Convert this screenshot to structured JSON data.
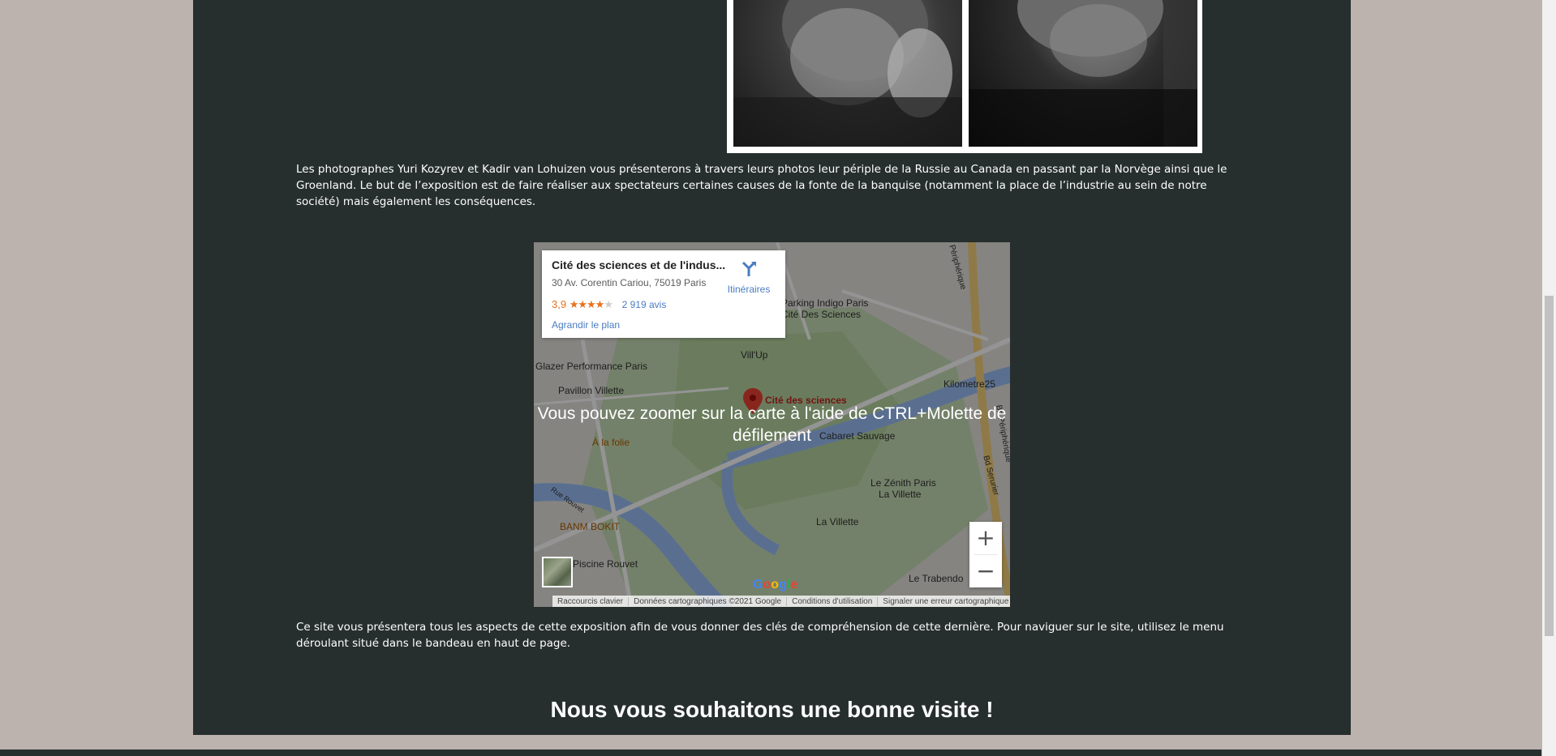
{
  "intro": {
    "paragraph": "Les photographes Yuri Kozyrev et Kadir van Lohuizen vous présenterons à travers leurs photos leur périple de la Russie au Canada en passant par la Norvège ainsi que le Groenland. Le but de l’exposition est de faire réaliser aux spectateurs certaines causes de la fonte de la banquise (notamment la place de l’industrie au sein de notre société) mais également les conséquences."
  },
  "map": {
    "card": {
      "place_name": "Cité des sciences et de l'indus...",
      "address": "30 Av. Corentin Cariou, 75019 Paris",
      "rating": "3,9",
      "rating_stars": 3.9,
      "reviews": "2 919 avis",
      "enlarge": "Agrandir le plan",
      "directions": "Itinéraires"
    },
    "zoom_hint": "Vous pouvez zoomer sur la carte à l'aide de CTRL+Molette de défilement",
    "labels": {
      "parking": "Parking Indigo Paris",
      "parking2": "Cité Des Sciences",
      "villup": "Vill'Up",
      "glazer": "Glazer Performance Paris",
      "pavillon": "Pavillon Villette",
      "kilometre": "Kilometre25",
      "cite": "Cité des sciences",
      "cabaret": "Cabaret Sauvage",
      "alafolie": "À la folie",
      "zenith": "Le Zénith Paris",
      "zenith2": "La Villette",
      "lavillette": "La Villette",
      "banm": "BANM BOKIT",
      "piscine": "Piscine Rouvet",
      "trabendo": "Le Trabendo",
      "rouvet": "Rue Rouvet",
      "serurier": "Bd Serurier",
      "peripherique": "Bd Périphérique",
      "periph_top": "Périphérique"
    },
    "zoom_in": "+",
    "zoom_out": "−",
    "google": "Google",
    "footer": {
      "shortcuts": "Raccourcis clavier",
      "data": "Données cartographiques ©2021 Google",
      "terms": "Conditions d'utilisation",
      "report": "Signaler une erreur cartographique"
    },
    "icons": {
      "directions": "directions-arrow-icon",
      "pin": "map-pin-icon"
    }
  },
  "outro": {
    "paragraph": "Ce site vous présentera tous les aspects de cette exposition afin de vous donner des clés de compréhension de cette dernière. Pour naviguer sur le site, utilisez le menu déroulant situé dans le bandeau en haut de page.",
    "closing": "Nous vous souhaitons une bonne visite !"
  },
  "colors": {
    "page_bg": "#bcb3ae",
    "content_bg": "#272e2e",
    "link": "#4a7cc2",
    "rating": "#e7711b"
  }
}
